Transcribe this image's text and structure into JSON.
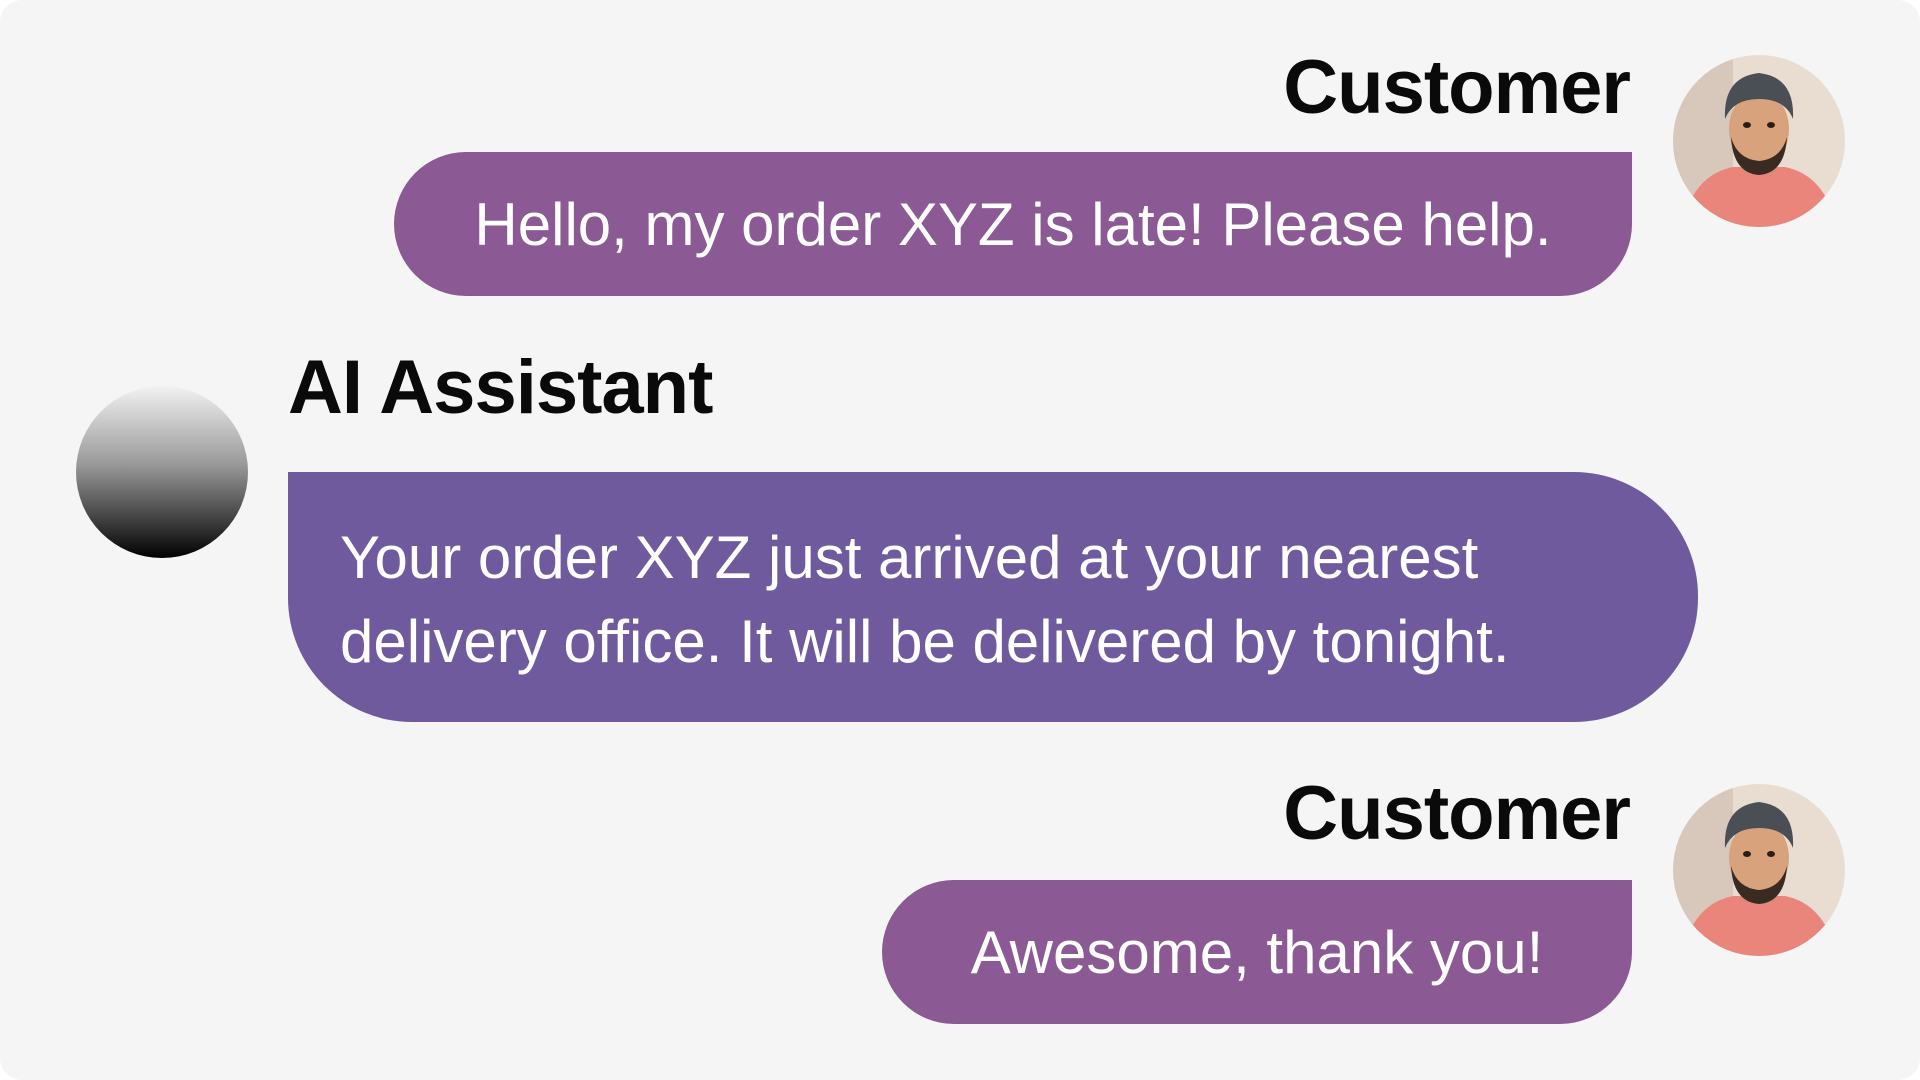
{
  "colors": {
    "background": "#f5f5f5",
    "customer_bubble": "#8b5993",
    "assistant_bubble": "#6f5a9e",
    "bubble_text": "#ffffff",
    "name_text": "#0a0a0a"
  },
  "messages": [
    {
      "sender": "Customer",
      "avatar": "person-photo-icon",
      "text": "Hello, my order XYZ is late! Please help."
    },
    {
      "sender": "AI Assistant",
      "avatar": "gradient-sphere-icon",
      "lines": [
        "Your order XYZ just arrived at your nearest",
        "delivery office. It will be delivered by tonight."
      ]
    },
    {
      "sender": "Customer",
      "avatar": "person-photo-icon",
      "text": "Awesome, thank you!"
    }
  ]
}
